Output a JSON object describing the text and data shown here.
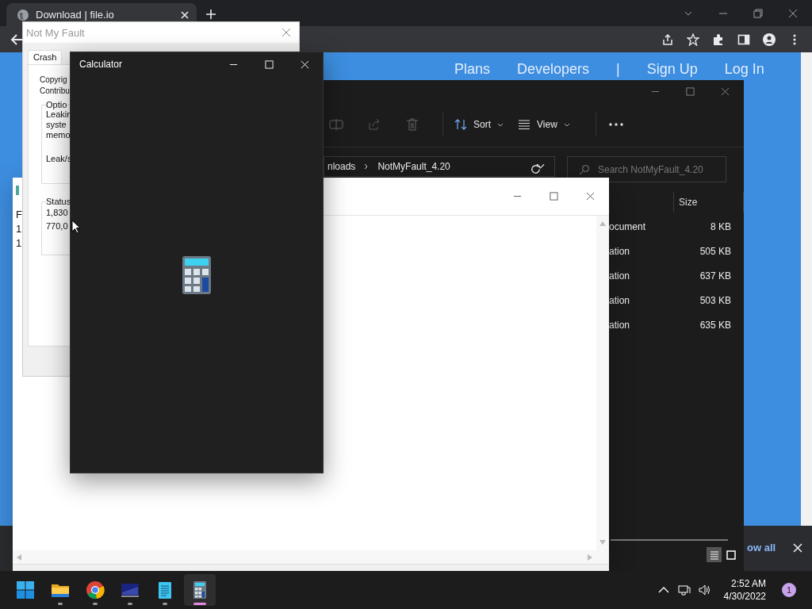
{
  "browser": {
    "tab": {
      "title": "Download | file.io"
    },
    "nav_links": [
      "Plans",
      "Developers",
      "|",
      "Sign Up",
      "Log In"
    ],
    "download_bar": {
      "show_all": "ow all"
    }
  },
  "background_window": {
    "lines": [
      "F",
      "1",
      "1"
    ]
  },
  "not_my_fault": {
    "title": "Not My Fault",
    "tabs": [
      {
        "label": "Crash",
        "selected": true
      }
    ],
    "info": [
      "Copyrig",
      "Contribu"
    ],
    "options_group": {
      "label": "Optio",
      "lines": [
        "Leakin",
        "syste",
        "memo"
      ],
      "leak_label": "Leak/s"
    },
    "status_group": {
      "label": "Status",
      "lines": [
        "1,830",
        "770,0"
      ]
    }
  },
  "explorer": {
    "commands": [
      "Sort",
      "View"
    ],
    "breadcrumb": [
      "nloads",
      "NotMyFault_4.20"
    ],
    "search": {
      "placeholder": "Search NotMyFault_4.20"
    },
    "columns": [
      "Size"
    ],
    "rows": [
      {
        "type": "ocument",
        "size": "8 KB"
      },
      {
        "type": "ation",
        "size": "505 KB"
      },
      {
        "type": "ation",
        "size": "637 KB"
      },
      {
        "type": "ation",
        "size": "503 KB"
      },
      {
        "type": "ation",
        "size": "635 KB"
      }
    ],
    "view_modes": [
      {
        "kind": "details",
        "selected": true
      },
      {
        "kind": "tiles",
        "selected": false
      }
    ]
  },
  "calculator": {
    "title": "Calculator"
  },
  "taskbar": {
    "apps": [
      {
        "kind": "start",
        "running": false,
        "active": false
      },
      {
        "kind": "folder",
        "running": true,
        "active": false
      },
      {
        "kind": "chrome",
        "running": true,
        "active": false
      },
      {
        "kind": "monitor",
        "running": true,
        "active": false
      },
      {
        "kind": "notepad",
        "running": true,
        "active": false
      },
      {
        "kind": "calculator",
        "running": true,
        "active": true
      }
    ],
    "clock": {
      "time": "2:52 AM",
      "date": "4/30/2022"
    },
    "notifications": "1"
  }
}
